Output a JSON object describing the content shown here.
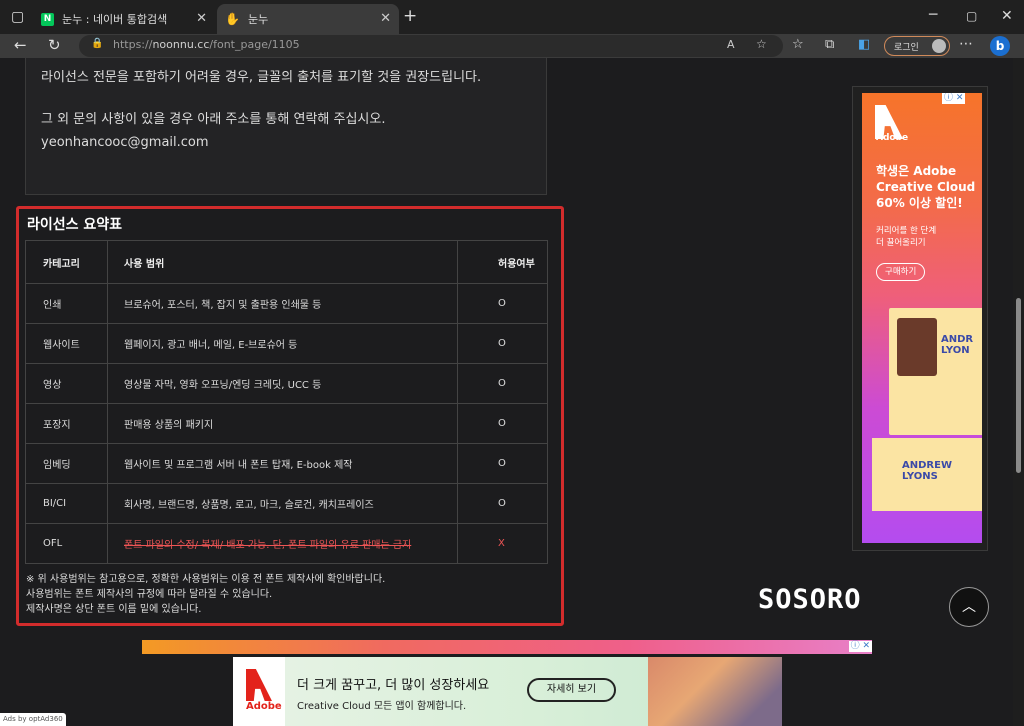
{
  "browser": {
    "tabs": [
      {
        "title": "눈누 : 네이버 통합검색"
      },
      {
        "title": "눈누"
      }
    ],
    "url_prefix": "https://",
    "url_domain": "noonnu.cc",
    "url_path": "/font_page/1105",
    "profile_label": "로그인"
  },
  "page": {
    "license_text_1": "라이선스 전문을 포함하기 어려울 경우, 글꼴의 출처를 표기할 것을 권장드립니다.",
    "contact_text": "그 외 문의 사항이 있을 경우 아래 주소를 통해 연락해 주십시오.",
    "contact_email": "yeonhancooc@gmail.com",
    "summary_title": "라이선스 요약표",
    "table_headers": [
      "카테고리",
      "사용 범위",
      "허용여부"
    ],
    "rows": [
      {
        "category": "인쇄",
        "scope": "브로슈어, 포스터, 책, 잡지 및 출판용 인쇄물 등",
        "allowed": "O"
      },
      {
        "category": "웹사이트",
        "scope": "웹페이지, 광고 배너, 메일, E-브로슈어 등",
        "allowed": "O"
      },
      {
        "category": "영상",
        "scope": "영상물 자막, 영화 오프닝/엔딩 크레딧, UCC 등",
        "allowed": "O"
      },
      {
        "category": "포장지",
        "scope": "판매용 상품의 패키지",
        "allowed": "O"
      },
      {
        "category": "임베딩",
        "scope": "웹사이트 및 프로그램 서버 내 폰트 탑재, E-book 제작",
        "allowed": "O"
      },
      {
        "category": "BI/CI",
        "scope": "회사명, 브랜드명, 상품명, 로고, 마크, 슬로건, 캐치프레이즈",
        "allowed": "O"
      },
      {
        "category": "OFL",
        "scope": "폰트 파일의 수정/ 복제/ 배포 가능. 단, 폰트 파일의 유료 판매는 금지",
        "allowed": "X"
      }
    ],
    "notes": [
      "※ 위 사용범위는 참고용으로, 정확한 사용범위는 이용 전 폰트 제작사에 확인바랍니다.",
      "사용범위는 폰트 제작사의 규정에 따라 달라질 수 있습니다.",
      "제작사명은 상단 폰트 이름 밑에 있습니다."
    ],
    "footer_logo": "SOSORO"
  },
  "ad_side": {
    "brand": "Adobe",
    "headline": [
      "학생은 Adobe",
      "Creative Cloud",
      "60% 이상 할인!"
    ],
    "sub": [
      "커리어를 한 단계",
      "더 끌어올리기"
    ],
    "button": "구매하기",
    "card_name": "ANDREW LYONS",
    "card_name2": "ANDR LYON"
  },
  "ad_bottom": {
    "brand": "Adobe",
    "headline": "더 크게 꿈꾸고, 더 많이 성장하세요",
    "sub": "Creative Cloud 모든 앱이 함께합니다.",
    "button": "자세히 보기",
    "ads_by": "Ads by optAd360"
  }
}
